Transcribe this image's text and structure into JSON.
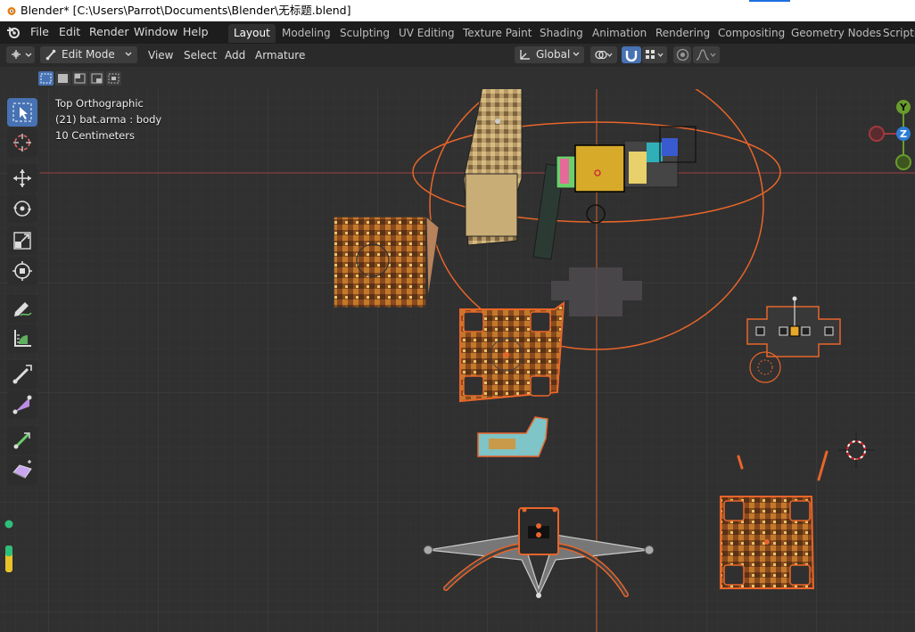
{
  "titlebar": {
    "title": "Blender* [C:\\Users\\Parrot\\Documents\\Blender\\无标题.blend]"
  },
  "menus": [
    "File",
    "Edit",
    "Render",
    "Window",
    "Help"
  ],
  "workspace_tabs": [
    "Layout",
    "Modeling",
    "Sculpting",
    "UV Editing",
    "Texture Paint",
    "Shading",
    "Animation",
    "Rendering",
    "Compositing",
    "Geometry Nodes",
    "Scripting"
  ],
  "active_workspace": "Layout",
  "header": {
    "mode": "Edit Mode",
    "menus": [
      "View",
      "Select",
      "Add",
      "Armature"
    ],
    "transform_orientation": "Global"
  },
  "viewport_info": {
    "view": "Top Orthographic",
    "object": "(21) bat.arma : body",
    "scale": "10 Centimeters"
  },
  "gizmo": {
    "y": "Y",
    "z": "Z"
  },
  "colors": {
    "accent": "#4772b3",
    "selection_orange": "#e8652a",
    "axis_red": "#a2393f",
    "axis_green": "#6a9c2b",
    "axis_blue": "#2d7cd6"
  }
}
